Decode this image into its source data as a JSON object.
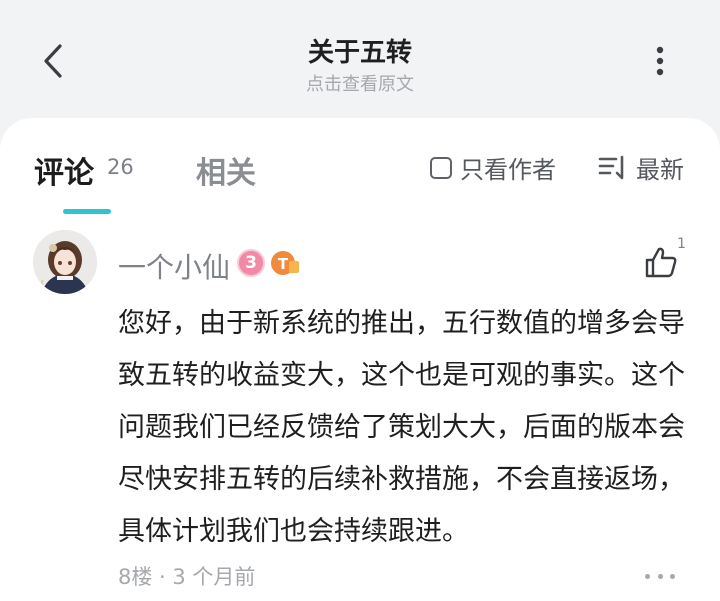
{
  "header": {
    "title": "关于五转",
    "subtitle": "点击查看原文",
    "back_icon": "chevron-left-icon",
    "more_icon": "vertical-ellipsis-icon"
  },
  "tabs": {
    "comments_label": "评论",
    "comments_count": "26",
    "related_label": "相关",
    "active_color": "#2ec4c9"
  },
  "filters": {
    "author_only_label": "只看作者",
    "sort_label": "最新",
    "sort_icon": "sort-icon"
  },
  "comment": {
    "username": "一个小仙",
    "level_badge": "3",
    "title_badge": "T",
    "like_count": "1",
    "body": "您好，由于新系统的推出，五行数值的增多会导致五转的收益变大，这个也是可观的事实。这个问题我们已经反馈给了策划大大，后面的版本会尽快安排五转的后续补救措施，不会直接返场，具体计划我们也会持续跟进。",
    "meta": "8楼 · 3 个月前"
  }
}
